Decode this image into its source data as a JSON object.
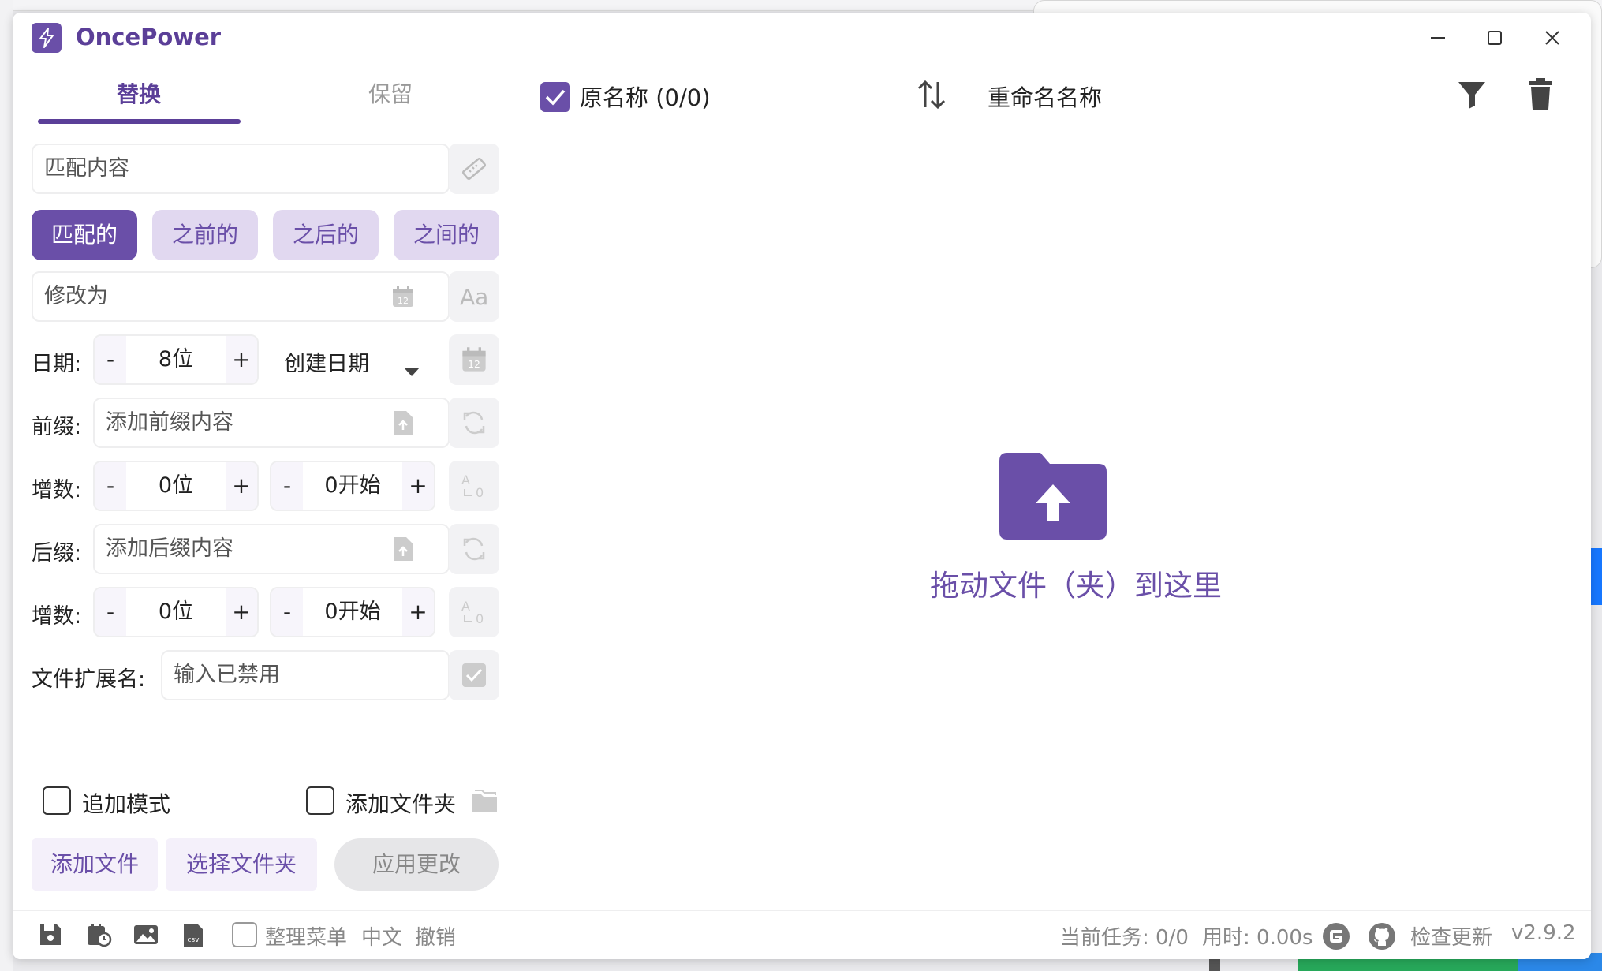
{
  "app": {
    "title": "OncePower",
    "version": "v2.9.2"
  },
  "tabs": {
    "active": "替换",
    "inactive": "保留"
  },
  "replace_panel": {
    "match_placeholder": "匹配内容",
    "match_modes": [
      "匹配的",
      "之前的",
      "之后的",
      "之间的"
    ],
    "active_mode": "匹配的",
    "replace_placeholder": "修改为",
    "date": {
      "label": "日期:",
      "minus": "-",
      "plus": "+",
      "digits": "8位",
      "type": "创建日期"
    },
    "prefix": {
      "label": "前缀:",
      "placeholder": "添加前缀内容"
    },
    "prefix_increment": {
      "label": "增数:",
      "digits": "0位",
      "start": "0开始"
    },
    "suffix": {
      "label": "后缀:",
      "placeholder": "添加后缀内容"
    },
    "suffix_increment": {
      "label": "增数:",
      "digits": "0位",
      "start": "0开始"
    },
    "extension": {
      "label": "文件扩展名:",
      "placeholder": "输入已禁用"
    }
  },
  "options": {
    "append_mode": "追加模式",
    "add_folder": "添加文件夹"
  },
  "actions": {
    "add_files": "添加文件",
    "select_folder": "选择文件夹",
    "apply_changes": "应用更改"
  },
  "file_list": {
    "original_name_label": "原名称 (0/0)",
    "rename_label": "重命名名称",
    "drop_hint": "拖动文件（夹）到这里"
  },
  "statusbar": {
    "organize_menu": "整理菜单",
    "language": "中文",
    "undo": "撤销",
    "current_task": "当前任务: 0/0",
    "elapsed": "用时: 0.00s",
    "check_update": "检查更新"
  },
  "colors": {
    "accent": "#6a4fa8",
    "accent_light": "#e1d8f0",
    "muted": "#888888"
  },
  "icons": {
    "logo": "lightning-icon",
    "ruler": "ruler-icon",
    "calendar": "calendar-icon",
    "font_case": "font-case-icon",
    "file_upload": "file-upload-icon",
    "refresh": "refresh-icon",
    "sort": "sort-icon",
    "filter": "filter-icon",
    "trash": "trash-icon",
    "folder_upload": "folder-upload-icon"
  }
}
